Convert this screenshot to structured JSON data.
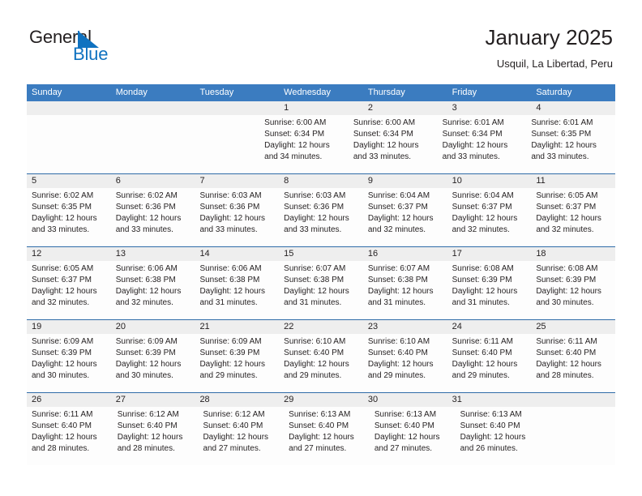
{
  "brand": {
    "name_part1": "General",
    "name_part2": "Blue",
    "flag_icon": "blue-triangle-flag-icon"
  },
  "header": {
    "title": "January 2025",
    "location": "Usquil, La Libertad, Peru"
  },
  "colors": {
    "header_blue": "#3b7cc0",
    "row_divider_blue": "#2f6ca8",
    "daynum_band": "#eeeeee",
    "brand_blue": "#0f72c0",
    "text": "#231f20"
  },
  "weekdays": [
    "Sunday",
    "Monday",
    "Tuesday",
    "Wednesday",
    "Thursday",
    "Friday",
    "Saturday"
  ],
  "weeks": [
    {
      "days": [
        {
          "num": "",
          "lines": []
        },
        {
          "num": "",
          "lines": []
        },
        {
          "num": "",
          "lines": []
        },
        {
          "num": "1",
          "lines": [
            "Sunrise: 6:00 AM",
            "Sunset: 6:34 PM",
            "Daylight: 12 hours",
            "and 34 minutes."
          ]
        },
        {
          "num": "2",
          "lines": [
            "Sunrise: 6:00 AM",
            "Sunset: 6:34 PM",
            "Daylight: 12 hours",
            "and 33 minutes."
          ]
        },
        {
          "num": "3",
          "lines": [
            "Sunrise: 6:01 AM",
            "Sunset: 6:34 PM",
            "Daylight: 12 hours",
            "and 33 minutes."
          ]
        },
        {
          "num": "4",
          "lines": [
            "Sunrise: 6:01 AM",
            "Sunset: 6:35 PM",
            "Daylight: 12 hours",
            "and 33 minutes."
          ]
        }
      ]
    },
    {
      "days": [
        {
          "num": "5",
          "lines": [
            "Sunrise: 6:02 AM",
            "Sunset: 6:35 PM",
            "Daylight: 12 hours",
            "and 33 minutes."
          ]
        },
        {
          "num": "6",
          "lines": [
            "Sunrise: 6:02 AM",
            "Sunset: 6:36 PM",
            "Daylight: 12 hours",
            "and 33 minutes."
          ]
        },
        {
          "num": "7",
          "lines": [
            "Sunrise: 6:03 AM",
            "Sunset: 6:36 PM",
            "Daylight: 12 hours",
            "and 33 minutes."
          ]
        },
        {
          "num": "8",
          "lines": [
            "Sunrise: 6:03 AM",
            "Sunset: 6:36 PM",
            "Daylight: 12 hours",
            "and 33 minutes."
          ]
        },
        {
          "num": "9",
          "lines": [
            "Sunrise: 6:04 AM",
            "Sunset: 6:37 PM",
            "Daylight: 12 hours",
            "and 32 minutes."
          ]
        },
        {
          "num": "10",
          "lines": [
            "Sunrise: 6:04 AM",
            "Sunset: 6:37 PM",
            "Daylight: 12 hours",
            "and 32 minutes."
          ]
        },
        {
          "num": "11",
          "lines": [
            "Sunrise: 6:05 AM",
            "Sunset: 6:37 PM",
            "Daylight: 12 hours",
            "and 32 minutes."
          ]
        }
      ]
    },
    {
      "days": [
        {
          "num": "12",
          "lines": [
            "Sunrise: 6:05 AM",
            "Sunset: 6:37 PM",
            "Daylight: 12 hours",
            "and 32 minutes."
          ]
        },
        {
          "num": "13",
          "lines": [
            "Sunrise: 6:06 AM",
            "Sunset: 6:38 PM",
            "Daylight: 12 hours",
            "and 32 minutes."
          ]
        },
        {
          "num": "14",
          "lines": [
            "Sunrise: 6:06 AM",
            "Sunset: 6:38 PM",
            "Daylight: 12 hours",
            "and 31 minutes."
          ]
        },
        {
          "num": "15",
          "lines": [
            "Sunrise: 6:07 AM",
            "Sunset: 6:38 PM",
            "Daylight: 12 hours",
            "and 31 minutes."
          ]
        },
        {
          "num": "16",
          "lines": [
            "Sunrise: 6:07 AM",
            "Sunset: 6:38 PM",
            "Daylight: 12 hours",
            "and 31 minutes."
          ]
        },
        {
          "num": "17",
          "lines": [
            "Sunrise: 6:08 AM",
            "Sunset: 6:39 PM",
            "Daylight: 12 hours",
            "and 31 minutes."
          ]
        },
        {
          "num": "18",
          "lines": [
            "Sunrise: 6:08 AM",
            "Sunset: 6:39 PM",
            "Daylight: 12 hours",
            "and 30 minutes."
          ]
        }
      ]
    },
    {
      "days": [
        {
          "num": "19",
          "lines": [
            "Sunrise: 6:09 AM",
            "Sunset: 6:39 PM",
            "Daylight: 12 hours",
            "and 30 minutes."
          ]
        },
        {
          "num": "20",
          "lines": [
            "Sunrise: 6:09 AM",
            "Sunset: 6:39 PM",
            "Daylight: 12 hours",
            "and 30 minutes."
          ]
        },
        {
          "num": "21",
          "lines": [
            "Sunrise: 6:09 AM",
            "Sunset: 6:39 PM",
            "Daylight: 12 hours",
            "and 29 minutes."
          ]
        },
        {
          "num": "22",
          "lines": [
            "Sunrise: 6:10 AM",
            "Sunset: 6:40 PM",
            "Daylight: 12 hours",
            "and 29 minutes."
          ]
        },
        {
          "num": "23",
          "lines": [
            "Sunrise: 6:10 AM",
            "Sunset: 6:40 PM",
            "Daylight: 12 hours",
            "and 29 minutes."
          ]
        },
        {
          "num": "24",
          "lines": [
            "Sunrise: 6:11 AM",
            "Sunset: 6:40 PM",
            "Daylight: 12 hours",
            "and 29 minutes."
          ]
        },
        {
          "num": "25",
          "lines": [
            "Sunrise: 6:11 AM",
            "Sunset: 6:40 PM",
            "Daylight: 12 hours",
            "and 28 minutes."
          ]
        }
      ]
    },
    {
      "days": [
        {
          "num": "26",
          "lines": [
            "Sunrise: 6:11 AM",
            "Sunset: 6:40 PM",
            "Daylight: 12 hours",
            "and 28 minutes."
          ]
        },
        {
          "num": "27",
          "lines": [
            "Sunrise: 6:12 AM",
            "Sunset: 6:40 PM",
            "Daylight: 12 hours",
            "and 28 minutes."
          ]
        },
        {
          "num": "28",
          "lines": [
            "Sunrise: 6:12 AM",
            "Sunset: 6:40 PM",
            "Daylight: 12 hours",
            "and 27 minutes."
          ]
        },
        {
          "num": "29",
          "lines": [
            "Sunrise: 6:13 AM",
            "Sunset: 6:40 PM",
            "Daylight: 12 hours",
            "and 27 minutes."
          ]
        },
        {
          "num": "30",
          "lines": [
            "Sunrise: 6:13 AM",
            "Sunset: 6:40 PM",
            "Daylight: 12 hours",
            "and 27 minutes."
          ]
        },
        {
          "num": "31",
          "lines": [
            "Sunrise: 6:13 AM",
            "Sunset: 6:40 PM",
            "Daylight: 12 hours",
            "and 26 minutes."
          ]
        },
        {
          "num": "",
          "lines": []
        }
      ]
    }
  ]
}
